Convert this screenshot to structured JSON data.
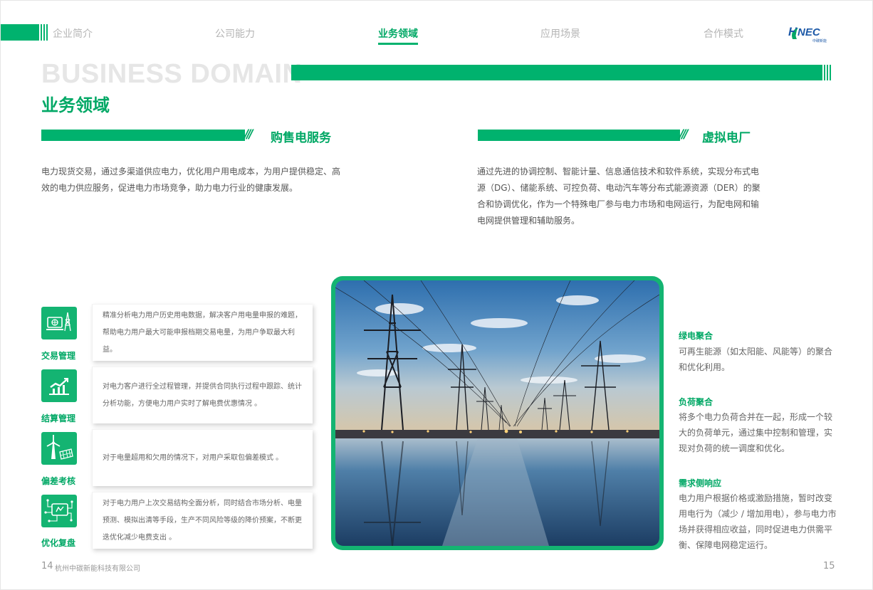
{
  "nav": {
    "items": [
      "企业简介",
      "公司能力",
      "业务领域",
      "应用场景",
      "合作模式"
    ],
    "active_index": 2
  },
  "logo": {
    "text": "HNEC",
    "subtext": "中碳新能"
  },
  "title": {
    "en": "BUSINESS DOMAIN",
    "cn": "业务领域"
  },
  "sections": [
    {
      "title": "购售电服务",
      "text": "电力现货交易，通过多渠道供应电力，优化用户用电成本，为用户提供稳定、高效的电力供应服务，促进电力市场竞争，助力电力行业的健康发展。"
    },
    {
      "title": "虚拟电厂",
      "text": "通过先进的协调控制、智能计量、信息通信技术和软件系统，实现分布式电源（DG）、储能系统、可控负荷、电动汽车等分布式能源资源（DER）的聚合和协调优化，作为一个特殊电厂参与电力市场和电网运行，为配电网和输电网提供管理和辅助服务。"
    }
  ],
  "features": [
    {
      "icon": "trading-icon",
      "label": "交易管理",
      "text": "精准分析电力用户历史用电数据，解决客户用电量申报的难题，帮助电力用户最大可能申报档期交易电量，为用户争取最大利益。"
    },
    {
      "icon": "settlement-icon",
      "label": "结算管理",
      "text": "对电力客户进行全过程管理，并提供合同执行过程中跟踪、统计分析功能，方便电力用户实时了解电费优惠情况 。"
    },
    {
      "icon": "wind-solar-icon",
      "label": "偏差考核",
      "text": "对于电量超用和欠用的情况下，对用户采取包偏差模式 。"
    },
    {
      "icon": "circuit-review-icon",
      "label": "优化复盘",
      "text": "对于电力用户上次交易结构全面分析，同时结合市场分析、电量预测、模拟出清等手段，生产不同风险等级的降价预案，不断更迭优化减少电费支出 。"
    }
  ],
  "right_items": [
    {
      "title": "绿电聚合",
      "text": "可再生能源（如太阳能、风能等）的聚合和优化利用。"
    },
    {
      "title": "负荷聚合",
      "text": "将多个电力负荷合并在一起，形成一个较大的负荷单元，通过集中控制和管理，实现对负荷的统一调度和优化。"
    },
    {
      "title": "需求侧响应",
      "text": "电力用户根据价格或激励措施，暂时改变用电行为（减少 / 增加用电），参与电力市场并获得相应收益，同时促进电力供需平衡、保障电网稳定运行。"
    }
  ],
  "footer": {
    "left_page": "14",
    "company": "杭州中碳新能科技有限公司",
    "right_page": "15"
  },
  "colors": {
    "accent": "#00b26e",
    "accent_text": "#00a865",
    "icon_bg": "#14b472"
  }
}
